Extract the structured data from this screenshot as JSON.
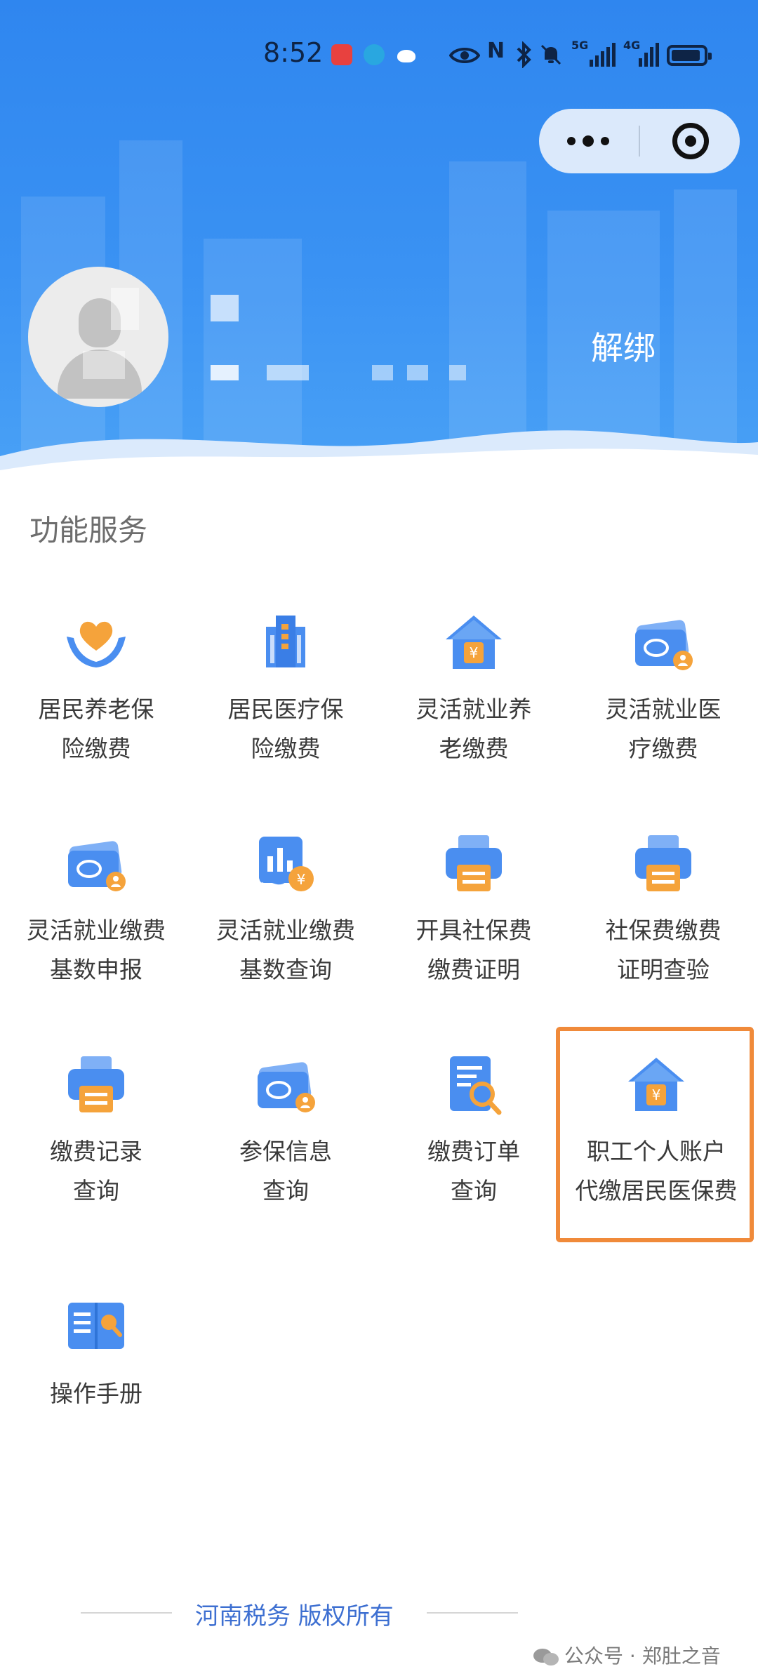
{
  "status_bar": {
    "time": "8:52",
    "icons": [
      "notification-red-icon",
      "browser-icon",
      "weather-icon",
      "eye-icon",
      "nfc-icon",
      "bluetooth-icon",
      "mute-icon",
      "5g-signal-icon",
      "4g-signal-icon",
      "battery-icon"
    ],
    "network_1": "5G",
    "network_2": "4G"
  },
  "mini_program_capsule": {
    "more_icon": "more-dots-icon",
    "close_icon": "close-target-icon"
  },
  "profile": {
    "unbind_label": "解绑"
  },
  "section": {
    "title": "功能服务"
  },
  "services": [
    {
      "line1": "居民养老保",
      "line2": "险缴费",
      "icon": "heart-hands-icon"
    },
    {
      "line1": "居民医疗保",
      "line2": "险缴费",
      "icon": "building-icon"
    },
    {
      "line1": "灵活就业养",
      "line2": "老缴费",
      "icon": "house-yuan-icon"
    },
    {
      "line1": "灵活就业医",
      "line2": "疗缴费",
      "icon": "social-security-card-icon"
    },
    {
      "line1": "灵活就业缴费",
      "line2": "基数申报",
      "icon": "social-security-card-icon"
    },
    {
      "line1": "灵活就业缴费",
      "line2": "基数查询",
      "icon": "chart-yuan-icon"
    },
    {
      "line1": "开具社保费",
      "line2": "缴费证明",
      "icon": "printer-icon"
    },
    {
      "line1": "社保费缴费",
      "line2": "证明查验",
      "icon": "printer-icon"
    },
    {
      "line1": "缴费记录",
      "line2": "查询",
      "icon": "printer-icon"
    },
    {
      "line1": "参保信息",
      "line2": "查询",
      "icon": "social-security-card-icon"
    },
    {
      "line1": "缴费订单",
      "line2": "查询",
      "icon": "document-search-icon"
    },
    {
      "line1": "职工个人账户",
      "line2": "代缴居民医保费",
      "icon": "house-yuan-icon"
    },
    {
      "line1": "操作手册",
      "line2": "",
      "icon": "manual-book-icon"
    }
  ],
  "colors": {
    "header_blue": "#2f86ef",
    "icon_blue": "#4a8ef0",
    "icon_orange": "#f5a33b",
    "highlight_orange": "#f08a3a",
    "footer_blue": "#3d6fd1"
  },
  "footer": {
    "text": "河南税务 版权所有"
  },
  "watermark": {
    "text": "公众号 · 郑肚之音"
  }
}
